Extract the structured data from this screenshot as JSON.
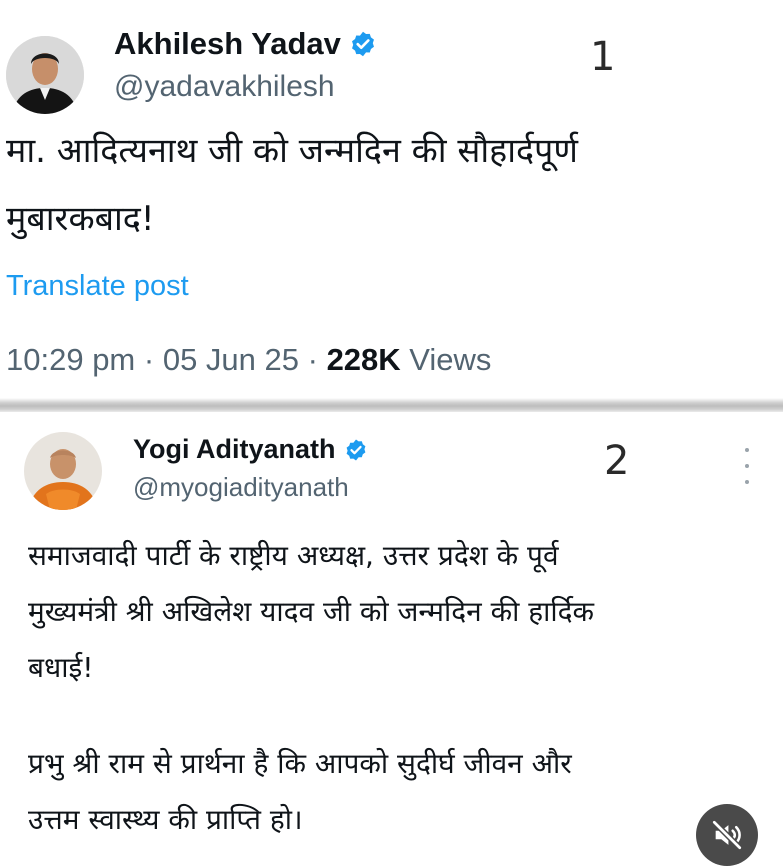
{
  "post1": {
    "author_name": "Akhilesh Yadav",
    "handle": "@yadavakhilesh",
    "number": "1",
    "text_line1": "मा. आदित्यनाथ जी को जन्मदिन की सौहार्दपूर्ण",
    "text_line2": "मुबारकबाद!",
    "translate_label": "Translate post",
    "time": "10:29 pm",
    "date": "05 Jun 25",
    "views_count": "228K",
    "views_label": "Views",
    "verified_color": "#1d9bf0",
    "avatar_icon": "akhilesh-avatar"
  },
  "post2": {
    "author_name": "Yogi Adityanath",
    "handle": "@myogiadityanath",
    "number": "2",
    "lines": [
      "समाजवादी पार्टी के राष्ट्रीय अध्यक्ष, उत्तर प्रदेश के पूर्व",
      "मुख्यमंत्री श्री अखिलेश यादव जी को जन्मदिन की हार्दिक",
      "बधाई!",
      "प्रभु श्री राम से प्रार्थना है कि आपको सुदीर्घ जीवन और",
      "उत्तम स्वास्थ्य की प्राप्ति हो।"
    ],
    "verified_color": "#1d9bf0",
    "avatar_icon": "yogi-avatar",
    "more_icon": "more-vertical-icon"
  },
  "overlay": {
    "mute_icon": "mute-icon"
  }
}
